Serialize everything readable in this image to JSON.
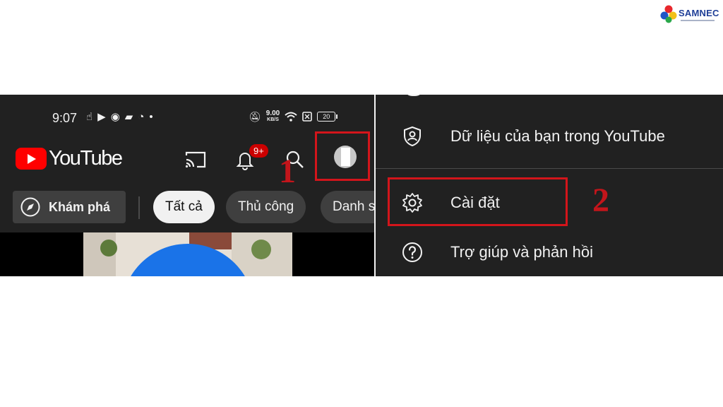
{
  "brand": {
    "name": "SAMNEC"
  },
  "left_panel": {
    "status_bar": {
      "time": "9:07",
      "net_speed_value": "9.00",
      "net_speed_unit": "KB/S",
      "battery": "20"
    },
    "header": {
      "logo_text": "YouTube",
      "notification_badge": "9+"
    },
    "step_label": "1",
    "chips": {
      "explore": "Khám phá",
      "items": [
        "Tất cả",
        "Thủ công",
        "Danh sách"
      ],
      "active_index": 0
    }
  },
  "right_panel": {
    "menu": {
      "items": [
        {
          "label": "Dữ liệu của bạn trong YouTube",
          "icon": "shield-person-icon"
        },
        {
          "label": "Cài đặt",
          "icon": "gear-icon"
        },
        {
          "label": "Trợ giúp và phản hồi",
          "icon": "help-circle-icon"
        }
      ]
    },
    "step_label": "2"
  },
  "colors": {
    "highlight": "#d3151b",
    "youtube_red": "#ff0000",
    "dark_bg": "#212121",
    "badge": "#cc0000"
  }
}
